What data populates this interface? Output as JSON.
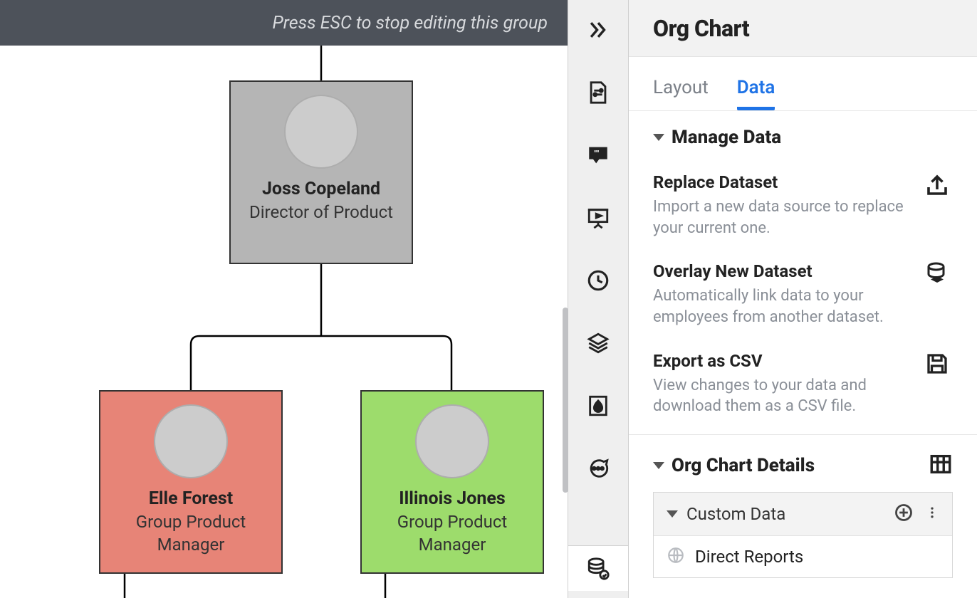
{
  "hint": "Press ESC to stop editing this group",
  "nodes": {
    "root": {
      "name": "Joss Copeland",
      "title": "Director of Product"
    },
    "left": {
      "name": "Elle Forest",
      "title": "Group Product Manager"
    },
    "right": {
      "name": "Illinois Jones",
      "title": "Group Product Manager"
    }
  },
  "panel": {
    "title": "Org Chart",
    "tabs": {
      "layout": "Layout",
      "data": "Data"
    },
    "manage": {
      "heading": "Manage Data",
      "replace": {
        "title": "Replace Dataset",
        "desc": "Import a new data source to replace your current one."
      },
      "overlay": {
        "title": "Overlay New Dataset",
        "desc": "Automatically link data to your employees from another dataset."
      },
      "export": {
        "title": "Export as CSV",
        "desc": "View changes to your data and download them as a CSV file."
      }
    },
    "details": {
      "heading": "Org Chart Details",
      "custom": {
        "label": "Custom Data"
      },
      "direct_reports": "Direct Reports"
    }
  }
}
